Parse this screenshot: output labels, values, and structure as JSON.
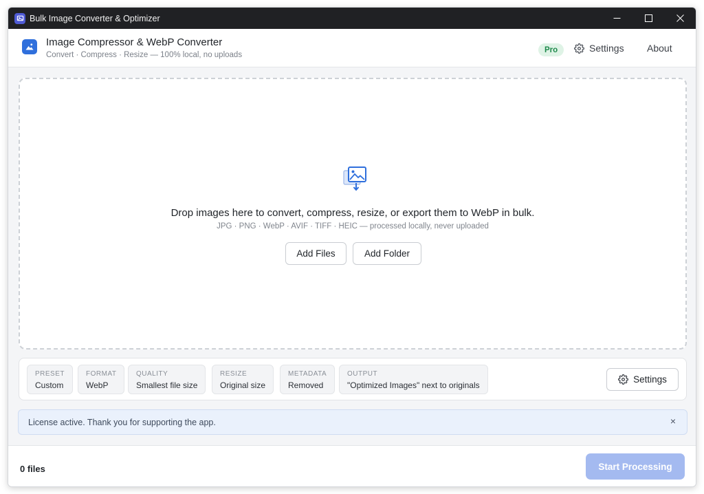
{
  "window": {
    "title": "Bulk Image Converter & Optimizer"
  },
  "header": {
    "title": "Image Compressor & WebP Converter",
    "subtitle": "Convert · Compress · Resize — 100% local, no uploads",
    "badge": "Pro",
    "settings_label": "Settings",
    "about_label": "About"
  },
  "dropzone": {
    "title": "Drop images here to convert, compress, resize, or export them to WebP in bulk.",
    "subtitle": "JPG · PNG · WebP · AVIF · TIFF · HEIC — processed locally, never uploaded",
    "add_files_label": "Add Files",
    "add_folder_label": "Add Folder"
  },
  "options": {
    "chips": [
      {
        "label": "PRESET",
        "value": "Custom"
      },
      {
        "label": "FORMAT",
        "value": "WebP"
      },
      {
        "label": "QUALITY",
        "value": "Smallest file size"
      },
      {
        "label": "RESIZE",
        "value": "Original size"
      },
      {
        "label": "METADATA",
        "value": "Removed"
      },
      {
        "label": "OUTPUT",
        "value": "\"Optimized Images\" next to originals"
      }
    ],
    "settings_label": "Settings"
  },
  "banner": {
    "text": "License active. Thank you for supporting the app.",
    "close": "×"
  },
  "footer": {
    "file_count": "0 files",
    "start_label": "Start Processing"
  },
  "colors": {
    "accent": "#2f6fdc",
    "start_disabled": "#a4baf0",
    "pro_badge_bg": "#dff3e6",
    "pro_badge_text": "#1f8a4c",
    "banner_bg": "#eaf1fc"
  }
}
